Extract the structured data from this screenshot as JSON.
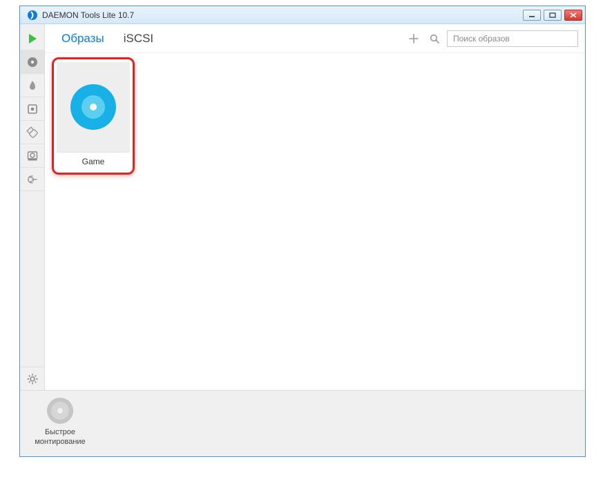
{
  "window": {
    "title": "DAEMON Tools Lite 10.7"
  },
  "tabs": {
    "images": "Образы",
    "iscsi": "iSCSI"
  },
  "search": {
    "placeholder": "Поиск образов"
  },
  "items": [
    {
      "label": "Game"
    }
  ],
  "quick_mount": {
    "line1": "Быстрое",
    "line2": "монтирование"
  }
}
